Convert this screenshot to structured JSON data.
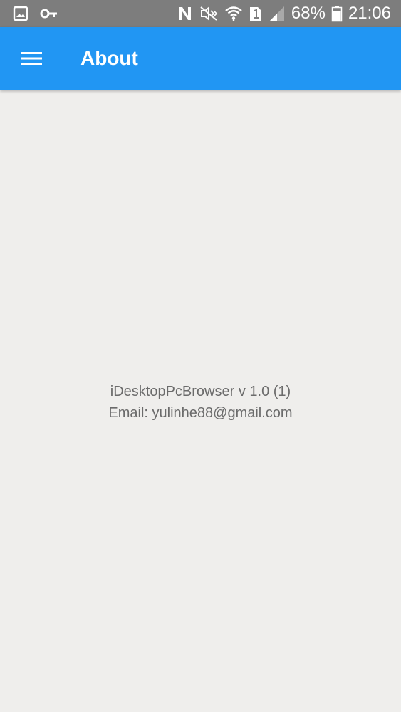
{
  "status_bar": {
    "icons": [
      "image-icon",
      "key-icon",
      "nfc-icon",
      "mute-icon",
      "wifi-icon",
      "sim-1-icon",
      "signal-icon",
      "battery-icon"
    ],
    "battery_percent": "68%",
    "time": "21:06"
  },
  "app_bar": {
    "menu_icon": "hamburger-menu-icon",
    "title": "About",
    "background_color": "#2196f3"
  },
  "about": {
    "version_line": "iDesktopPcBrowser v 1.0 (1)",
    "email_line": "Email: yulinhe88@gmail.com"
  }
}
